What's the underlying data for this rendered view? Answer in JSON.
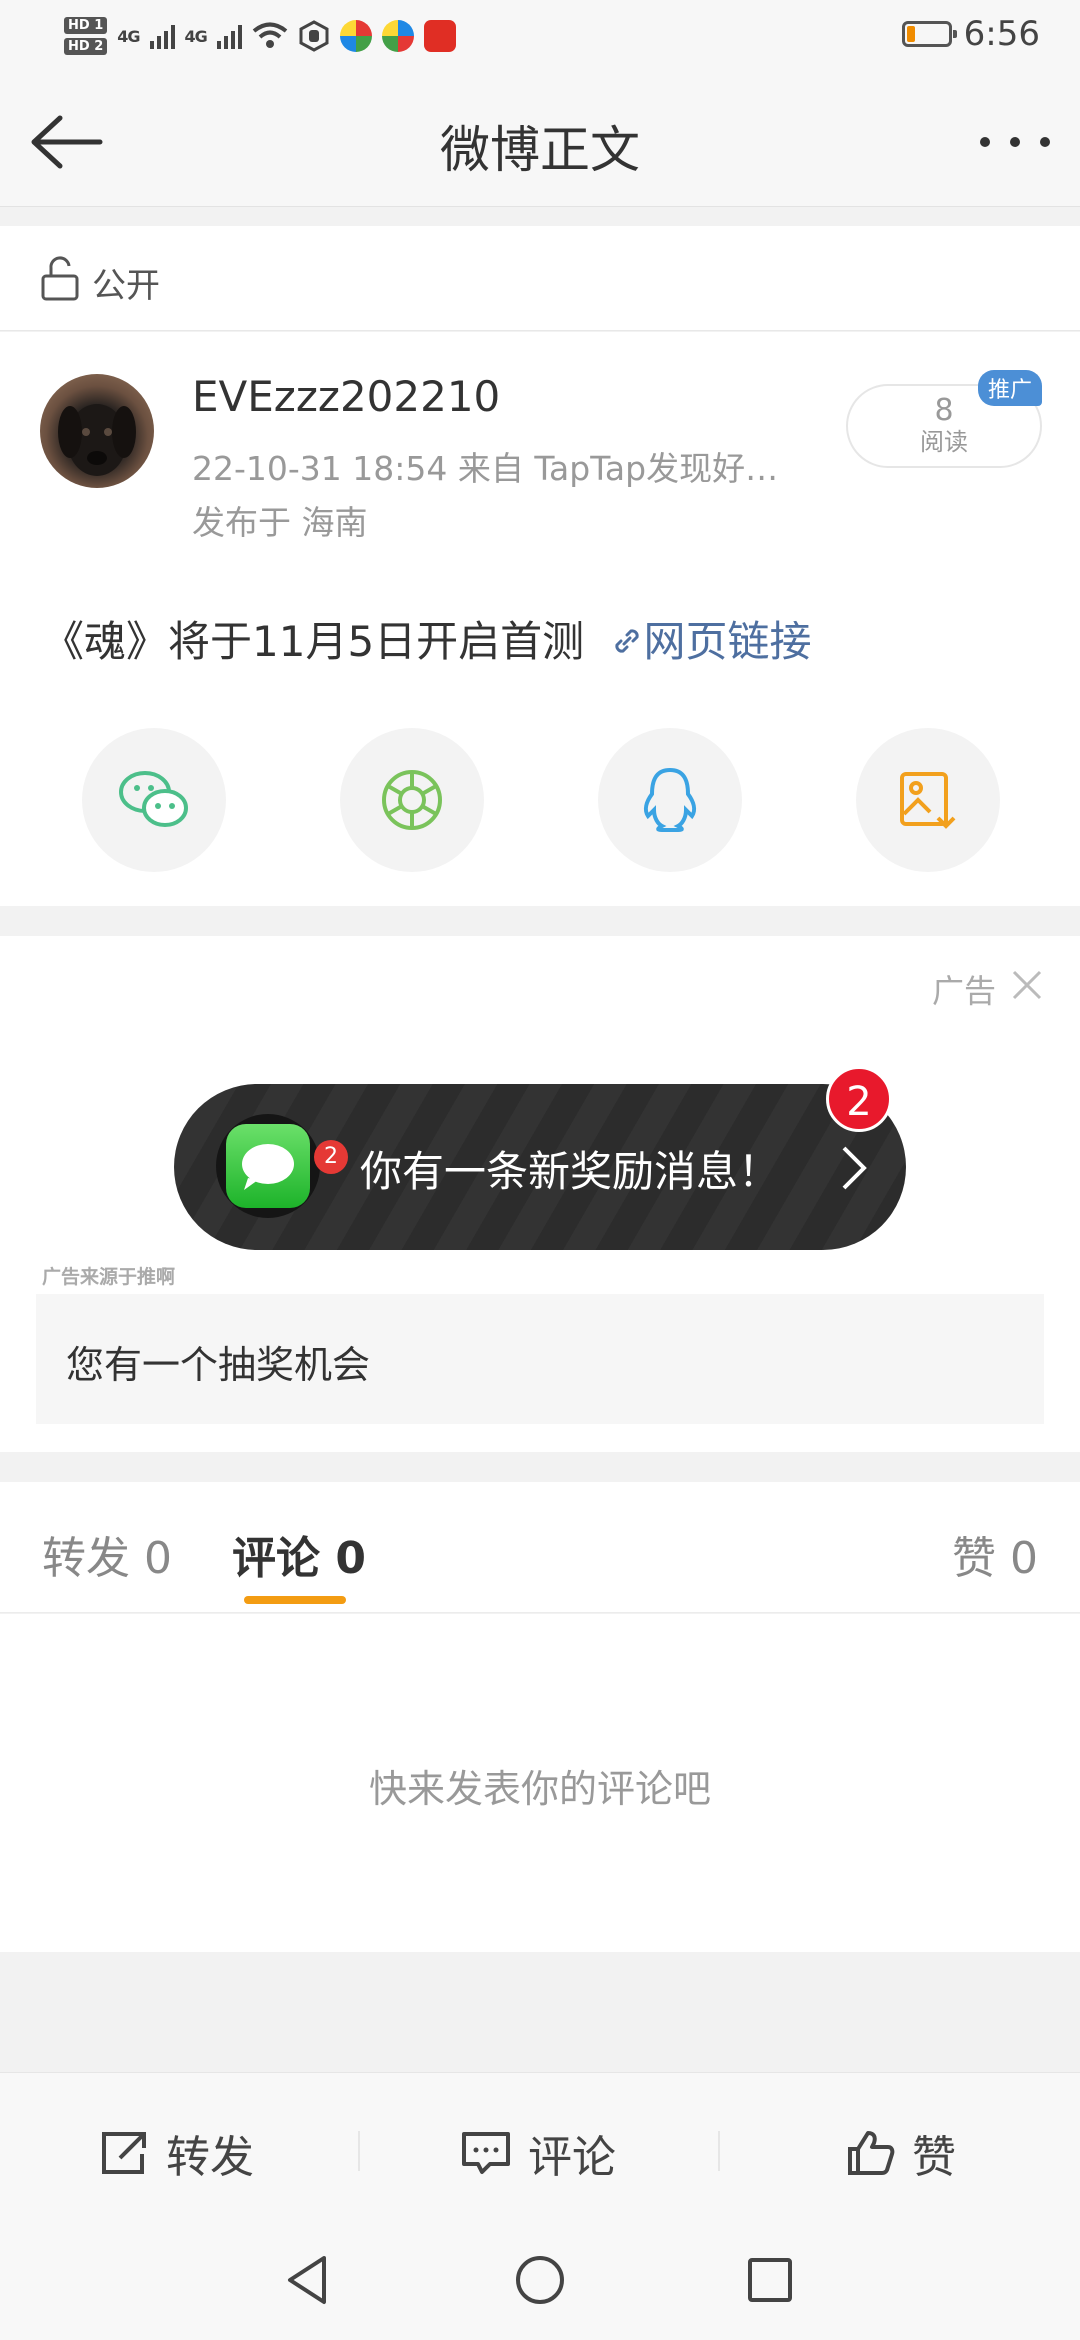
{
  "status_bar": {
    "hd1": "HD 1",
    "hd2": "HD 2",
    "net1": "4G",
    "net2": "4G",
    "time": "6:56",
    "battery_level": 0.2
  },
  "header": {
    "title": "微博正文"
  },
  "visibility": {
    "label": "公开"
  },
  "post": {
    "username": "EVEzzz202210",
    "meta_line1": "22-10-31 18:54   来自 TapTap发现好…",
    "meta_line2": "发布于 海南",
    "reads_count": "8",
    "reads_label": "阅读",
    "promo_badge": "推广",
    "text": "《魂》将于11月5日开启首测",
    "link_text": "网页链接",
    "share_icons": [
      "wechat-icon",
      "moments-icon",
      "qq-icon",
      "save-image-icon"
    ]
  },
  "ad": {
    "label": "广告",
    "banner_text": "你有一条新奖励消息！",
    "banner_badge": "2",
    "app_badge": "2",
    "source": "广告来源于推啊",
    "card_text": "您有一个抽奖机会"
  },
  "tabs": {
    "repost": "转发 0",
    "comment": "评论 0",
    "like": "赞 0"
  },
  "comments": {
    "empty": "快来发表你的评论吧"
  },
  "action_bar": {
    "repost": "转发",
    "comment": "评论",
    "like": "赞"
  },
  "colors": {
    "accent": "#f39c12",
    "link": "#4e6fa0",
    "promo": "#4c8fd6"
  }
}
